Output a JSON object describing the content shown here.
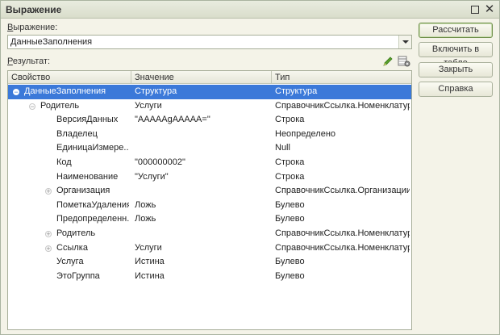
{
  "window": {
    "title": "Выражение"
  },
  "expression": {
    "label_first": "В",
    "label_rest": "ыражение:",
    "value": "ДанныеЗаполнения"
  },
  "result": {
    "label_first": "Р",
    "label_rest": "езультат:"
  },
  "columns": [
    "Свойство",
    "Значение",
    "Тип"
  ],
  "rows": [
    {
      "name": "ДанныеЗаполнения",
      "value": "Структура",
      "type": "Структура",
      "indent": 0,
      "toggle": "minus",
      "selected": true
    },
    {
      "name": "Родитель",
      "value": "Услуги",
      "type": "СправочникСсылка.Номенклатура",
      "indent": 1,
      "toggle": "minus"
    },
    {
      "name": "ВерсияДанных",
      "value": "\"AAAAAgAAAAA=\"",
      "type": "Строка",
      "indent": 2,
      "toggle": ""
    },
    {
      "name": "Владелец",
      "value": "",
      "type": "Неопределено",
      "indent": 2,
      "toggle": ""
    },
    {
      "name": "ЕдиницаИзмере...",
      "value": "",
      "type": "Null",
      "indent": 2,
      "toggle": ""
    },
    {
      "name": "Код",
      "value": "\"000000002\"",
      "type": "Строка",
      "indent": 2,
      "toggle": ""
    },
    {
      "name": "Наименование",
      "value": "\"Услуги\"",
      "type": "Строка",
      "indent": 2,
      "toggle": ""
    },
    {
      "name": "Организация",
      "value": "",
      "type": "СправочникСсылка.Организации",
      "indent": 2,
      "toggle": "plus"
    },
    {
      "name": "ПометкаУдаления",
      "value": "Ложь",
      "type": "Булево",
      "indent": 2,
      "toggle": ""
    },
    {
      "name": "Предопределенн...",
      "value": "Ложь",
      "type": "Булево",
      "indent": 2,
      "toggle": ""
    },
    {
      "name": "Родитель",
      "value": "",
      "type": "СправочникСсылка.Номенклатура",
      "indent": 2,
      "toggle": "plus"
    },
    {
      "name": "Ссылка",
      "value": "Услуги",
      "type": "СправочникСсылка.Номенклатура",
      "indent": 2,
      "toggle": "plus"
    },
    {
      "name": "Услуга",
      "value": "Истина",
      "type": "Булево",
      "indent": 2,
      "toggle": ""
    },
    {
      "name": "ЭтоГруппа",
      "value": "Истина",
      "type": "Булево",
      "indent": 2,
      "toggle": ""
    }
  ],
  "buttons": {
    "calculate": "Рассчитать",
    "include_in_table": "Включить в табло",
    "close": "Закрыть",
    "help": "Справка"
  },
  "icons": {
    "edit": "pencil-icon",
    "settings": "table-settings-icon",
    "maximize": "maximize-icon",
    "close": "close-icon"
  }
}
